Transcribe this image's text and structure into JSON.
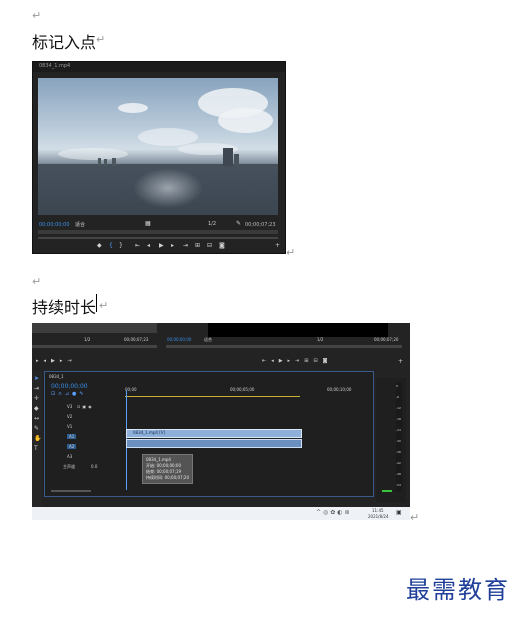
{
  "sections": [
    {
      "title": "标记入点"
    },
    {
      "title": "持续时长"
    }
  ],
  "para_mark": "↵",
  "monitor": {
    "tab": "0834_1.mp4",
    "timecode_left": "00;00;00;00",
    "fit_label": "适合",
    "quality": "1/2",
    "timecode_right": "00;00;07;23"
  },
  "timeline": {
    "top_left_quality": "1/2",
    "top_left_tc": "00;00;07;23",
    "top_mid_tc": "00;00;00;00",
    "top_mid_fit": "适合",
    "top_right_quality": "1/2",
    "top_right_tc": "00;00;07;20",
    "sequence_tab": "0834_1",
    "playhead_tc": "00;00;00;00",
    "ruler": [
      "00;00",
      "00;00;05;00",
      "00;00;10;00"
    ],
    "video_tracks": [
      "V3",
      "V2",
      "V1"
    ],
    "audio_tracks": [
      "A1",
      "A2",
      "A3"
    ],
    "master_label": "主声道",
    "master_value": "0.0",
    "clip_video_label": "0834_1.mp4 [V]",
    "tooltip": [
      "0834_1.mp4",
      "开始: 00;00;00;00",
      "结束: 00;00;07;19",
      "持续时间: 00;00;07;20"
    ],
    "meter_scale": [
      "0",
      "-6",
      "-12",
      "-18",
      "-24",
      "-30",
      "-36",
      "-42",
      "-48",
      "-54"
    ]
  },
  "taskbar": {
    "time": "11:45",
    "date": "2021/8/24"
  },
  "brand": "最需教育"
}
